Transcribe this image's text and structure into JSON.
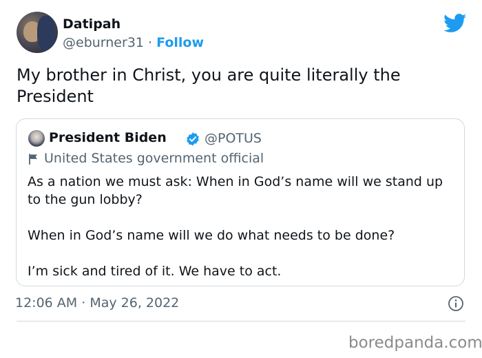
{
  "tweet": {
    "author": {
      "name": "Datipah",
      "handle": "@eburner31",
      "separator": "·",
      "follow_label": "Follow"
    },
    "text": "My brother in Christ, you are quite literally the President",
    "quoted": {
      "name": "President Biden",
      "handle": "@POTUS",
      "label": "United States government official",
      "paragraphs": [
        "As a nation we must ask: When in God’s name will we stand up to the gun lobby?",
        "When in God’s name will we do what needs to be done?",
        "I’m sick and tired of it. We have to act."
      ]
    },
    "timestamp": {
      "time": "12:06 AM",
      "separator": "·",
      "date": "May 26, 2022"
    }
  },
  "icons": {
    "brand": "twitter-bird-icon",
    "verified": "verified-badge-icon",
    "label": "flag-icon",
    "info": "info-icon"
  },
  "colors": {
    "accent": "#1d9bf0",
    "secondary_text": "#536471",
    "border": "#cfd9de"
  },
  "watermark": "boredpanda.com"
}
